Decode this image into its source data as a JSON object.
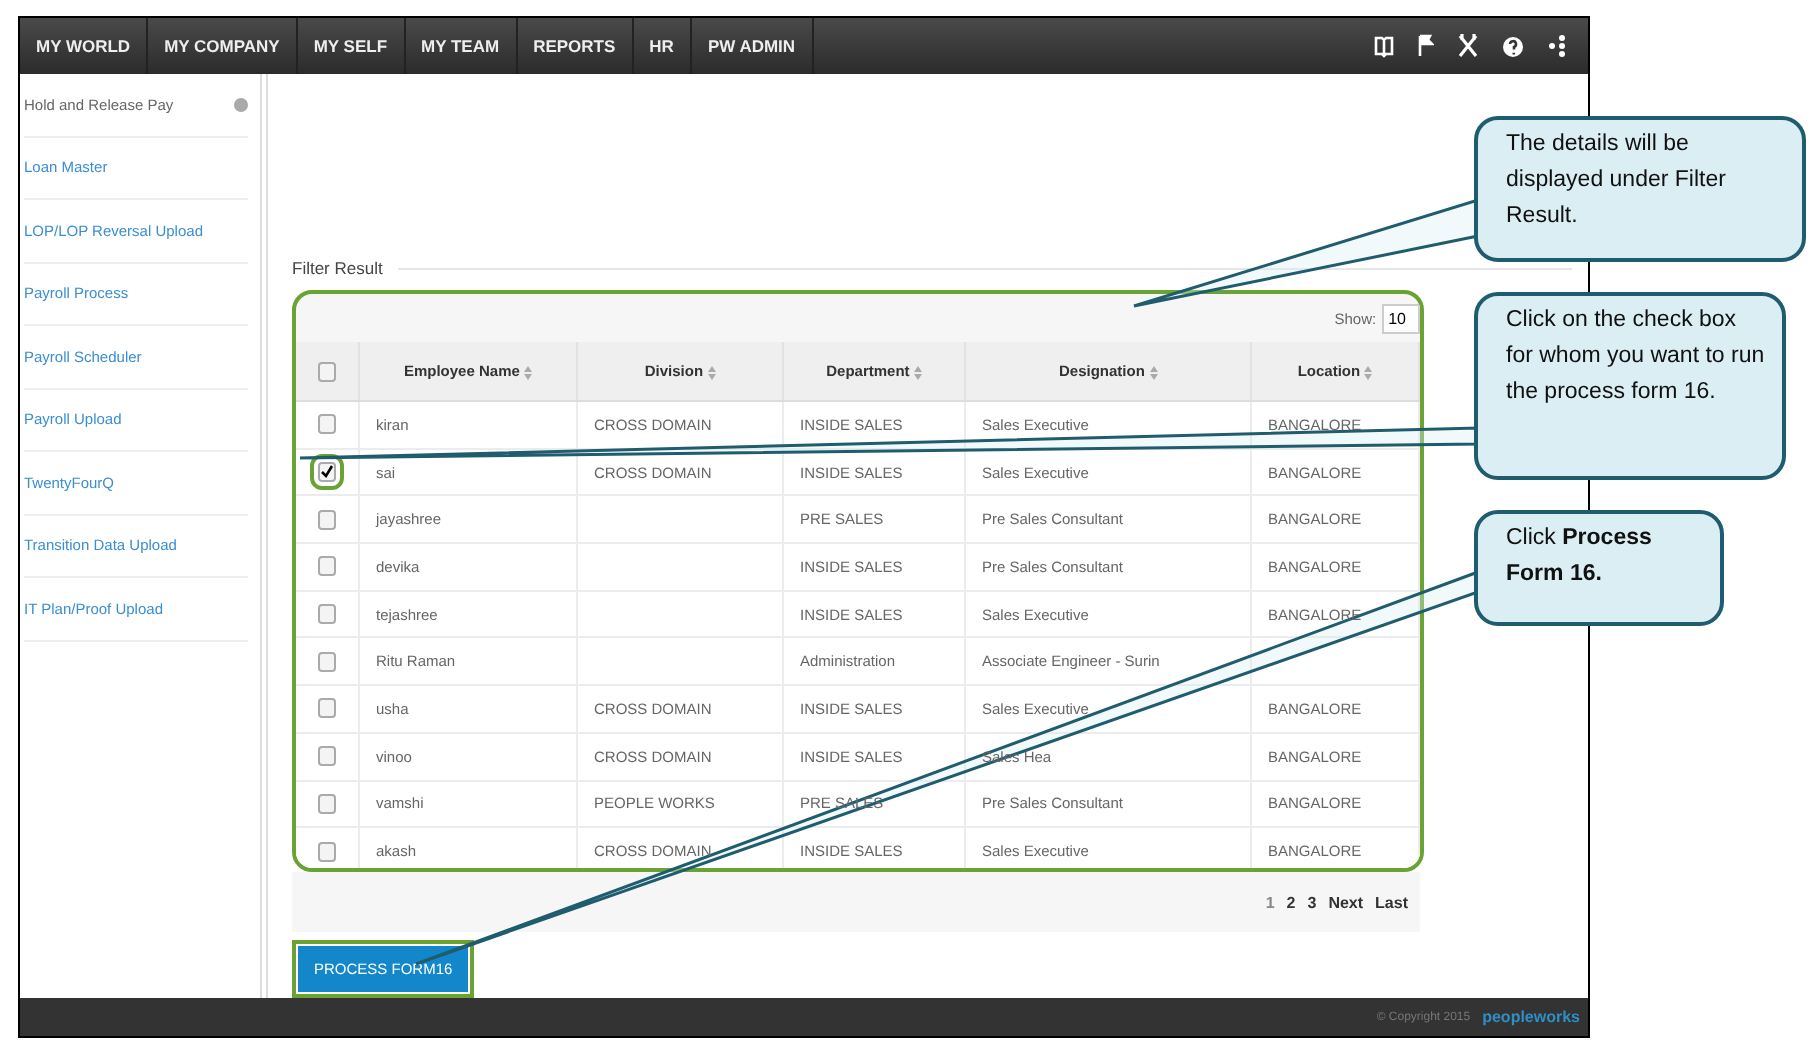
{
  "nav": {
    "items": [
      {
        "label": "MY WORLD"
      },
      {
        "label": "MY COMPANY"
      },
      {
        "label": "MY SELF"
      },
      {
        "label": "MY TEAM"
      },
      {
        "label": "REPORTS"
      },
      {
        "label": "HR"
      },
      {
        "label": "PW ADMIN"
      }
    ]
  },
  "sidebar": {
    "items": [
      {
        "label": "Hold and Release Pay",
        "selected": true
      },
      {
        "label": "Loan Master",
        "selected": false
      },
      {
        "label": "LOP/LOP Reversal Upload",
        "selected": false
      },
      {
        "label": "Payroll Process",
        "selected": false
      },
      {
        "label": "Payroll Scheduler",
        "selected": false
      },
      {
        "label": "Payroll Upload",
        "selected": false
      },
      {
        "label": "TwentyFourQ",
        "selected": false
      },
      {
        "label": "Transition Data Upload",
        "selected": false
      },
      {
        "label": "IT Plan/Proof Upload",
        "selected": false
      }
    ]
  },
  "filter_result": {
    "title": "Filter Result",
    "show_label": "Show:",
    "show_value": "10",
    "select_all_checked": false,
    "columns": [
      "Employee Name",
      "Division",
      "Department",
      "Designation",
      "Location"
    ],
    "rows": [
      {
        "checked": false,
        "cells": [
          "kiran",
          "CROSS DOMAIN",
          "INSIDE SALES",
          "Sales Executive",
          "BANGALORE"
        ]
      },
      {
        "checked": true,
        "cells": [
          "sai",
          "CROSS DOMAIN",
          "INSIDE SALES",
          "Sales Executive",
          "BANGALORE"
        ]
      },
      {
        "checked": false,
        "cells": [
          "jayashree",
          "",
          "PRE SALES",
          "Pre Sales Consultant",
          "BANGALORE"
        ]
      },
      {
        "checked": false,
        "cells": [
          "devika",
          "",
          "INSIDE SALES",
          "Pre Sales Consultant",
          "BANGALORE"
        ]
      },
      {
        "checked": false,
        "cells": [
          "tejashree",
          "",
          "INSIDE SALES",
          "Sales Executive",
          "BANGALORE"
        ]
      },
      {
        "checked": false,
        "cells": [
          "Ritu Raman",
          "",
          "Administration",
          "Associate Engineer - Surin",
          ""
        ]
      },
      {
        "checked": false,
        "cells": [
          "usha",
          "CROSS DOMAIN",
          "INSIDE SALES",
          "Sales Executive",
          "BANGALORE"
        ]
      },
      {
        "checked": false,
        "cells": [
          "vinoo",
          "CROSS DOMAIN",
          "INSIDE SALES",
          "Sales Hea",
          "BANGALORE"
        ]
      },
      {
        "checked": false,
        "cells": [
          "vamshi",
          "PEOPLE WORKS",
          "PRE SALES",
          "Pre Sales Consultant",
          "BANGALORE"
        ]
      },
      {
        "checked": false,
        "cells": [
          "akash",
          "CROSS DOMAIN",
          "INSIDE SALES",
          "Sales Executive",
          "BANGALORE"
        ]
      }
    ],
    "pages": [
      {
        "label": "1",
        "selected": true
      },
      {
        "label": "2",
        "selected": false
      },
      {
        "label": "3",
        "selected": false
      },
      {
        "label": "Next",
        "selected": false
      },
      {
        "label": "Last",
        "selected": false
      }
    ]
  },
  "process_button": "PROCESS FORM16",
  "footer": {
    "copyright": "© Copyright 2015",
    "logo": "peopleworks"
  },
  "callouts": [
    {
      "text": "The details will be displayed under Filter Result."
    },
    {
      "text": "Click on the check box for whom you want to run the process form 16."
    },
    {
      "text": "Click **Process Form 16.**"
    }
  ]
}
